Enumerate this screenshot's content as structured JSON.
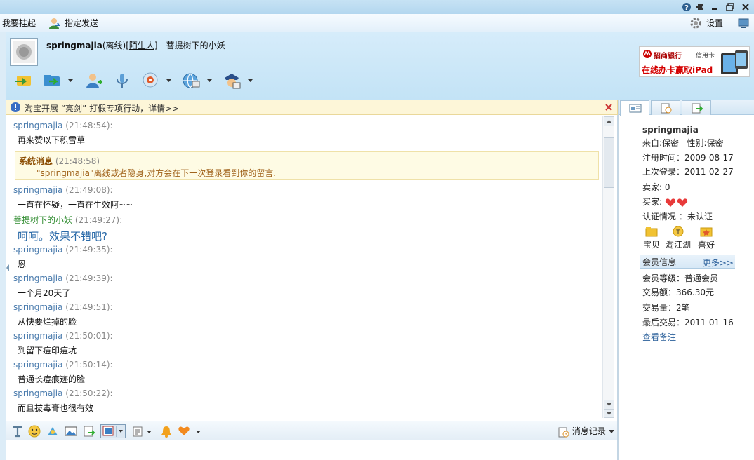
{
  "toolbar": {
    "hangup_label": "我要挂起",
    "assign_send_label": "指定发送",
    "settings_label": "设置"
  },
  "contact": {
    "name": "springmajia",
    "status": "(离线)",
    "relation_open": "[",
    "relation": "陌生人",
    "relation_close": "]",
    "sep": " - ",
    "signature": "菩提树下的小妖"
  },
  "ad": {
    "bank": "招商银行",
    "card": "信用卡",
    "promo": "在线办卡赢取iPad"
  },
  "notice": {
    "text": "淘宝开展 “亮剑” 打假专项行动，详情>>"
  },
  "messages": [
    {
      "sender": "springmajia",
      "time": "(21:48:54):",
      "text": "再来赞以下积雪草"
    },
    {
      "sender": "springmajia",
      "time": "(21:49:08):",
      "text": "一直在怀疑，一直在生效阿~~"
    },
    {
      "sender": "菩提树下的小妖",
      "time": "(21:49:27):",
      "text": "呵呵。效果不错吧?"
    },
    {
      "sender": "springmajia",
      "time": "(21:49:35):",
      "text": "恩"
    },
    {
      "sender": "springmajia",
      "time": "(21:49:39):",
      "text": "一个月20天了"
    },
    {
      "sender": "springmajia",
      "time": "(21:49:51):",
      "text": "从快要烂掉的脸"
    },
    {
      "sender": "springmajia",
      "time": "(21:50:01):",
      "text": "到留下痘印痘坑"
    },
    {
      "sender": "springmajia",
      "time": "(21:50:14):",
      "text": "普通长痘痕迹的脸"
    },
    {
      "sender": "springmajia",
      "time": "(21:50:22):",
      "text": "而且拔毒膏也很有效"
    }
  ],
  "system_message": {
    "title": "系统消息",
    "time": "(21:48:58)",
    "text": "\"springmajia\"离线或者隐身,对方会在下一次登录看到你的留言."
  },
  "input_toolbar": {
    "history_label": "消息记录"
  },
  "profile": {
    "name": "springmajia",
    "from": "来自:保密",
    "gender": "性别:保密",
    "registered": "注册时间：2009-08-17",
    "last_login": "上次登录：2011-02-27",
    "seller": "卖家: 0",
    "buyer": "买家:",
    "verification": "认证情况 ：未认证",
    "shop_buttons": [
      "宝贝",
      "淘江湖",
      "喜好"
    ]
  },
  "member": {
    "header": "会员信息",
    "more": "更多>>",
    "level": "会员等级：普通会员",
    "amount": "交易额：366.30元",
    "count": "交易量：2笔",
    "last_trade": "最后交易：2011-01-16",
    "notes": "查看备注"
  }
}
